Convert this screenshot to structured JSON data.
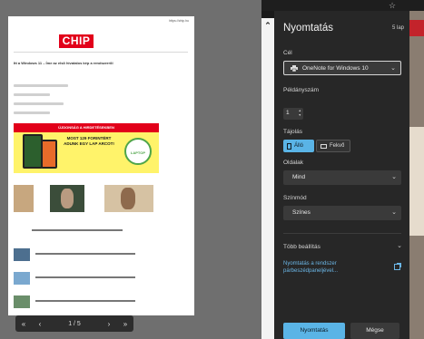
{
  "preview": {
    "page_url": "https://chip.hu",
    "logo_text": "CHIP",
    "headline": "Itt a Windows 11 – Íme az elsõ hivatalos kép a rendszerrõl",
    "ad": {
      "top_text": "ÚJDONSÁG A HIRDETÉSEKBEN",
      "main_text": "MOST 129 FORINTÉRT ADUNK EGY LAP ARCOT!",
      "circle_text": "LAPTOP"
    },
    "pager": {
      "first": "«",
      "prev": "‹",
      "page_text": "1 / 5",
      "next": "›",
      "last": "»"
    }
  },
  "scrollbar": {
    "up_arrow": "⌃"
  },
  "panel": {
    "title": "Nyomtatás",
    "help_label": "5 lap",
    "destination": {
      "label": "Cél",
      "value": "OneNote for Windows 10"
    },
    "copies": {
      "label": "Példányszám",
      "value": "1"
    },
    "orientation": {
      "label": "Tájolás",
      "portrait": "Álló",
      "landscape": "Fekvő"
    },
    "pages": {
      "label": "Oldalak",
      "value": "Mind"
    },
    "color": {
      "label": "Színmód",
      "value": "Színes"
    },
    "more_settings": "Több beállítás",
    "system_dialog_link": "Nyomtatás a rendszer párbeszédpaneljével...",
    "print_button": "Nyomtatás",
    "cancel_button": "Mégse"
  },
  "colors": {
    "panel_bg": "#272727",
    "accent": "#5ab4e6",
    "link": "#6bb6e6",
    "logo_red": "#e2001a"
  }
}
